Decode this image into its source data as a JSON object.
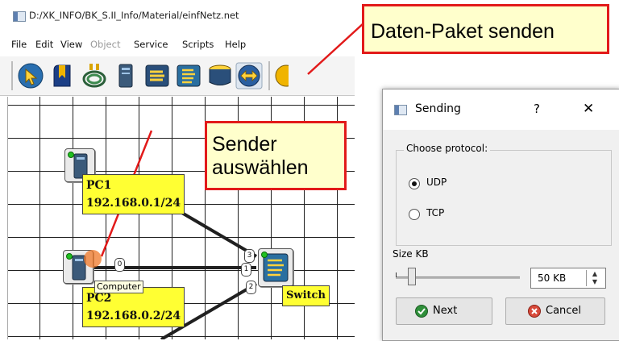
{
  "window": {
    "title": "D:/XK_INFO/BK_S.II_Info/Material/einfNetz.net"
  },
  "menu": {
    "items": [
      {
        "label": "File"
      },
      {
        "label": "Edit"
      },
      {
        "label": "View"
      },
      {
        "label": "Object",
        "disabled": true
      },
      {
        "label": "Service"
      },
      {
        "label": "Scripts"
      },
      {
        "label": "Help"
      }
    ]
  },
  "toolbar": {
    "buttons": [
      "select-icon",
      "text-icon",
      "cable-icon",
      "computer-icon",
      "switch-icon",
      "router-icon",
      "hub-icon",
      "send-packet-icon"
    ]
  },
  "network": {
    "pc1": {
      "name": "PC1",
      "ip": "192.168.0.1/24"
    },
    "pc2": {
      "name": "PC2",
      "ip": "192.168.0.2/24"
    },
    "switch": {
      "name": "Switch"
    },
    "tooltip": "Computer",
    "ports": {
      "pc2": "0",
      "sw_a": "3",
      "sw_b": "1",
      "sw_c": "2"
    }
  },
  "callouts": {
    "send": "Daten-Paket senden",
    "sender_line1": "Sender",
    "sender_line2": "auswählen"
  },
  "dialog": {
    "title": "Sending",
    "help": "?",
    "close": "✕",
    "group_label": "Choose protocol:",
    "protocols": [
      {
        "label": "UDP",
        "checked": true
      },
      {
        "label": "TCP",
        "checked": false
      }
    ],
    "size_label": "Size KB",
    "size_value": "50 KB",
    "slider_level": 0.13,
    "next": "Next",
    "cancel": "Cancel"
  },
  "colors": {
    "callout_border": "#e21a1a",
    "callout_fill": "#ffffcc",
    "node_label": "#ffff33"
  }
}
